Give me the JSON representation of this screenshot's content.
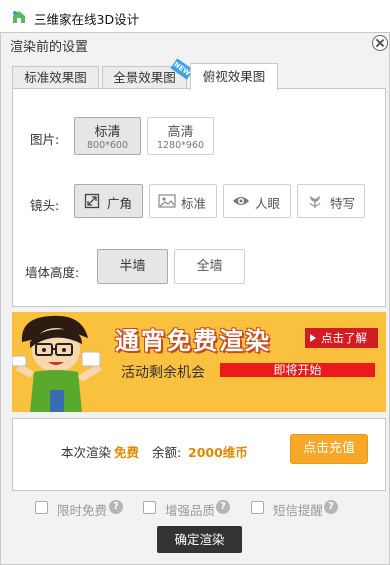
{
  "window": {
    "title": "三维家在线3D设计",
    "icon": "app-logo-icon"
  },
  "dialog": {
    "title": "渲染前的设置",
    "close_icon": "close-icon"
  },
  "tabs": [
    {
      "label": "标准效果图",
      "active": false
    },
    {
      "label": "全景效果图",
      "active": false,
      "badge": "NEW"
    },
    {
      "label": "俯视效果图",
      "active": true
    }
  ],
  "settings": {
    "image": {
      "label": "图片:",
      "options": [
        {
          "main": "标清",
          "sub": "800*600",
          "selected": true
        },
        {
          "main": "高清",
          "sub": "1280*960",
          "selected": false
        }
      ]
    },
    "lens": {
      "label": "镜头:",
      "options": [
        {
          "label": "广角",
          "icon": "wide-angle-icon",
          "selected": true
        },
        {
          "label": "标准",
          "icon": "image-icon",
          "selected": false
        },
        {
          "label": "人眼",
          "icon": "eye-icon",
          "selected": false
        },
        {
          "label": "特写",
          "icon": "flower-icon",
          "selected": false
        }
      ]
    },
    "wall": {
      "label": "墙体高度:",
      "options": [
        {
          "label": "半墙",
          "selected": true
        },
        {
          "label": "全墙",
          "selected": false
        }
      ]
    }
  },
  "banner": {
    "title": "通宵免费渲染",
    "cta": "点击了解",
    "subtitle": "活动剩余机会",
    "bar_text": "即将开始"
  },
  "cost": {
    "label": "本次渲染",
    "free": "免费",
    "balance_label": "余额:",
    "balance": "2000维币",
    "recharge": "点击充值"
  },
  "checkboxes": [
    {
      "label": "限时免费",
      "checked": false
    },
    {
      "label": "增强品质",
      "checked": false
    },
    {
      "label": "短信提醒",
      "checked": false
    }
  ],
  "confirm_label": "确定渲染",
  "colors": {
    "accent": "#f7a828",
    "banner_bg": "#f9c13e",
    "promo_red": "#ea1b1b",
    "confirm_bg": "#333333"
  }
}
